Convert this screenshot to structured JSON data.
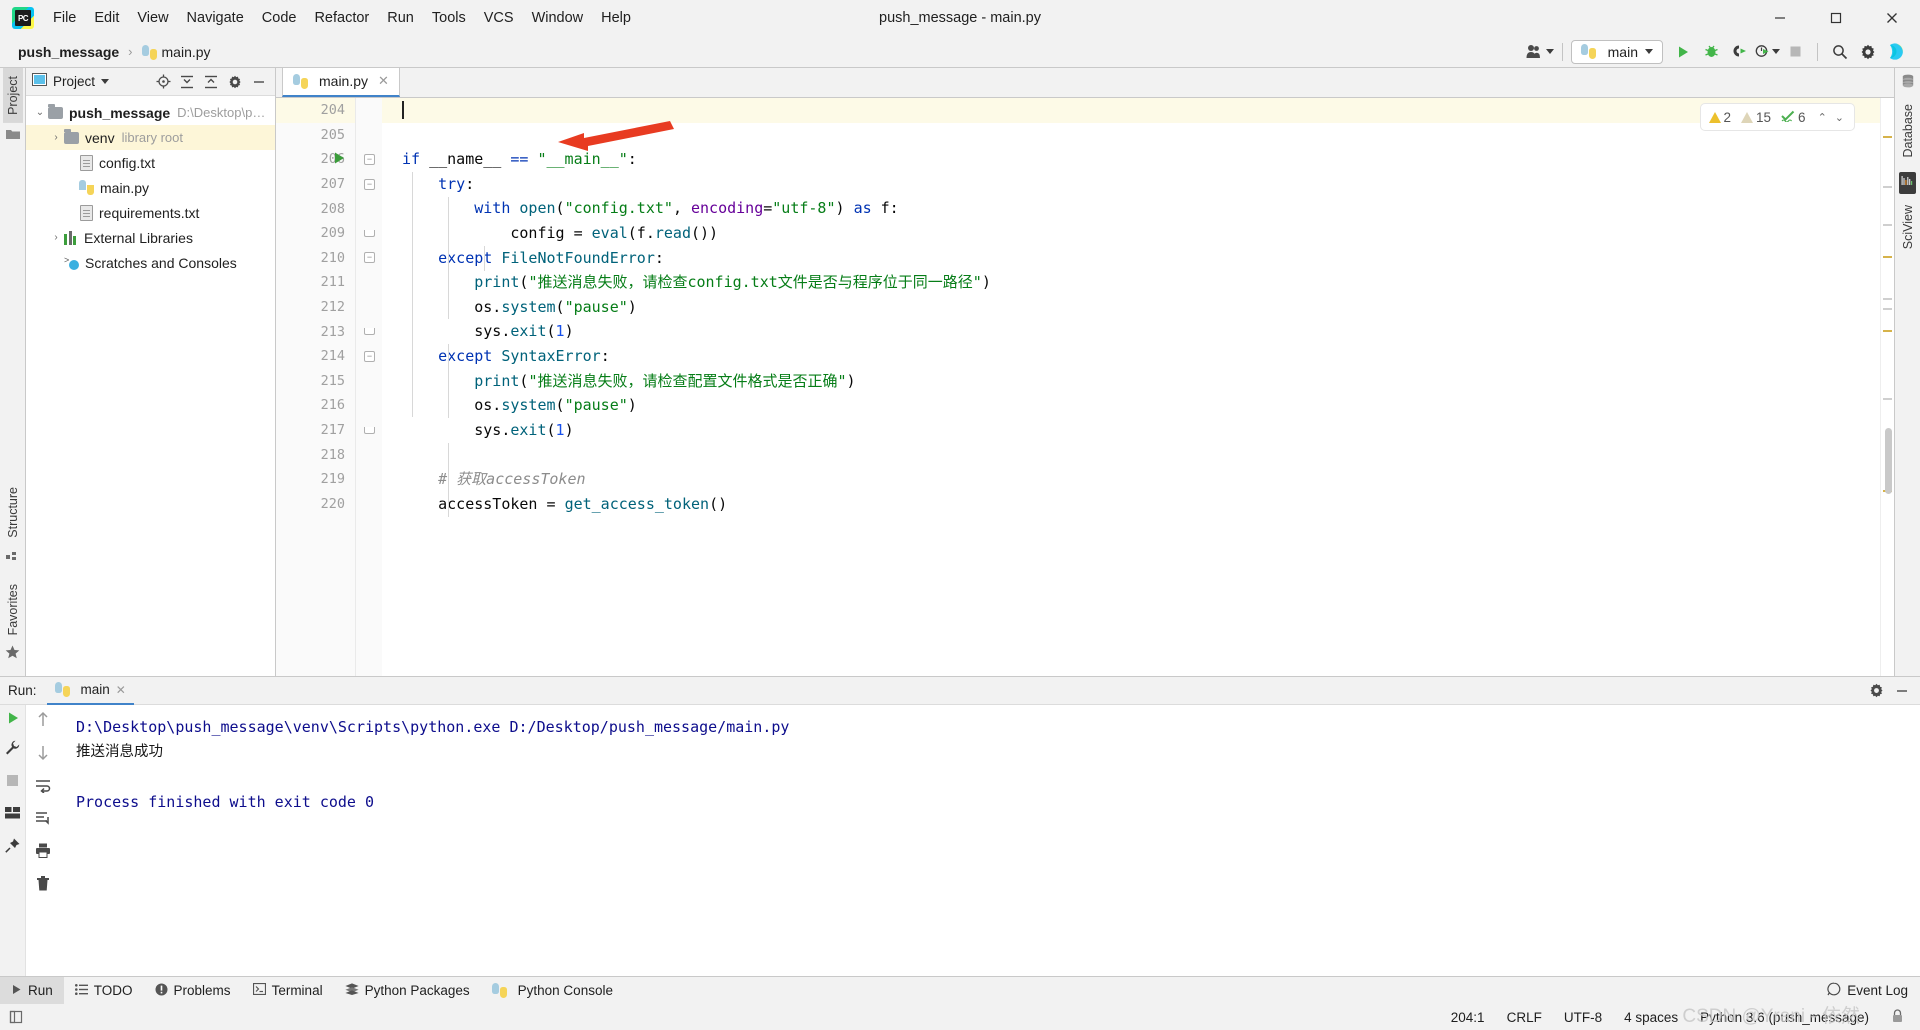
{
  "window": {
    "title": "push_message - main.py",
    "app_icon": "pycharm-logo-icon",
    "minimize": "–",
    "maximize": "▢",
    "close": "✕"
  },
  "menu": [
    {
      "label": "File"
    },
    {
      "label": "Edit"
    },
    {
      "label": "View"
    },
    {
      "label": "Navigate"
    },
    {
      "label": "Code"
    },
    {
      "label": "Refactor"
    },
    {
      "label": "Run"
    },
    {
      "label": "Tools"
    },
    {
      "label": "VCS"
    },
    {
      "label": "Window"
    },
    {
      "label": "Help"
    }
  ],
  "breadcrumb": {
    "project": "push_message",
    "separator": "›",
    "file": "main.py"
  },
  "toolbar": {
    "account_icon": "user-account-icon",
    "run_config_name": "main",
    "run_config_icon": "python-file-icon",
    "run_icon": "run-play-icon",
    "debug_icon": "debug-bug-icon",
    "run_coverage_icon": "run-with-coverage-icon",
    "profile_icon": "profiler-icon",
    "stop_icon": "stop-icon",
    "search_icon": "search-icon",
    "settings_icon": "gear-icon",
    "updates_icon": "ide-updates-icon"
  },
  "left_rail": {
    "project_tab": "Project",
    "structure_tab": "Structure",
    "favorites_tab": "Favorites"
  },
  "right_rail": {
    "database_tab": "Database",
    "sciview_tab": "SciView"
  },
  "project_panel": {
    "title": "Project",
    "dropdown_icon": "chevron-down-icon",
    "icons": [
      "locate-icon",
      "expand-all-icon",
      "collapse-all-icon",
      "gear-icon",
      "hide-icon"
    ],
    "tree": [
      {
        "label": "push_message",
        "hint": "D:\\Desktop\\push_m",
        "icon": "folder-icon",
        "depth": 0,
        "expanded": true,
        "bold": true,
        "selected": false
      },
      {
        "label": "venv",
        "hint": "library root",
        "icon": "folder-icon",
        "depth": 1,
        "expanded": false,
        "bold": false,
        "selected": true
      },
      {
        "label": "config.txt",
        "hint": "",
        "icon": "text-file-icon",
        "depth": 2,
        "expanded": null,
        "bold": false,
        "selected": false
      },
      {
        "label": "main.py",
        "hint": "",
        "icon": "python-file-icon",
        "depth": 2,
        "expanded": null,
        "bold": false,
        "selected": false
      },
      {
        "label": "requirements.txt",
        "hint": "",
        "icon": "text-file-icon",
        "depth": 2,
        "expanded": null,
        "bold": false,
        "selected": false
      },
      {
        "label": "External Libraries",
        "hint": "",
        "icon": "libraries-icon",
        "depth": 0,
        "expanded": false,
        "bold": false,
        "selected": false
      },
      {
        "label": "Scratches and Consoles",
        "hint": "",
        "icon": "scratches-icon",
        "depth": 1,
        "expanded": null,
        "bold": false,
        "selected": false
      }
    ]
  },
  "editor": {
    "tab": {
      "label": "main.py",
      "icon": "python-file-icon",
      "close": "✕"
    },
    "inspection": {
      "warning_count": "2",
      "weak_warning_count": "15",
      "typo_count": "6",
      "prev_icon": "chevron-up-icon",
      "next_icon": "chevron-down-icon"
    },
    "lines": [
      {
        "num": "204",
        "highlight": true,
        "gutter_run": false,
        "fold": "",
        "indent": 0,
        "tokens": [
          {
            "t": "caret",
            "v": ""
          }
        ]
      },
      {
        "num": "205",
        "highlight": false,
        "gutter_run": false,
        "fold": "",
        "indent": 0,
        "tokens": []
      },
      {
        "num": "206",
        "highlight": false,
        "gutter_run": true,
        "fold": "open",
        "indent": 0,
        "tokens": [
          {
            "t": "kw",
            "v": "if"
          },
          {
            "t": "id",
            "v": " __name__ "
          },
          {
            "t": "kw",
            "v": "=="
          },
          {
            "t": "id",
            "v": " "
          },
          {
            "t": "str",
            "v": "\"__main__\""
          },
          {
            "t": "id",
            "v": ":"
          }
        ]
      },
      {
        "num": "207",
        "highlight": false,
        "gutter_run": false,
        "fold": "open",
        "indent": 1,
        "tokens": [
          {
            "t": "kw",
            "v": "try"
          },
          {
            "t": "id",
            "v": ":"
          }
        ]
      },
      {
        "num": "208",
        "highlight": false,
        "gutter_run": false,
        "fold": "",
        "indent": 2,
        "tokens": [
          {
            "t": "kw",
            "v": "with"
          },
          {
            "t": "id",
            "v": " "
          },
          {
            "t": "fn",
            "v": "open"
          },
          {
            "t": "id",
            "v": "("
          },
          {
            "t": "str",
            "v": "\"config.txt\""
          },
          {
            "t": "id",
            "v": ", "
          },
          {
            "t": "param",
            "v": "encoding"
          },
          {
            "t": "id",
            "v": "="
          },
          {
            "t": "str",
            "v": "\"utf-8\""
          },
          {
            "t": "id",
            "v": ") "
          },
          {
            "t": "kw",
            "v": "as"
          },
          {
            "t": "id",
            "v": " f:"
          }
        ]
      },
      {
        "num": "209",
        "highlight": false,
        "gutter_run": false,
        "fold": "end",
        "indent": 3,
        "tokens": [
          {
            "t": "id",
            "v": "config = "
          },
          {
            "t": "fn",
            "v": "eval"
          },
          {
            "t": "id",
            "v": "(f."
          },
          {
            "t": "fn",
            "v": "read"
          },
          {
            "t": "id",
            "v": "())"
          }
        ]
      },
      {
        "num": "210",
        "highlight": false,
        "gutter_run": false,
        "fold": "open",
        "indent": 1,
        "tokens": [
          {
            "t": "kw",
            "v": "except"
          },
          {
            "t": "id",
            "v": " "
          },
          {
            "t": "fn",
            "v": "FileNotFoundError"
          },
          {
            "t": "id",
            "v": ":"
          }
        ]
      },
      {
        "num": "211",
        "highlight": false,
        "gutter_run": false,
        "fold": "",
        "indent": 2,
        "tokens": [
          {
            "t": "fn",
            "v": "print"
          },
          {
            "t": "id",
            "v": "("
          },
          {
            "t": "str",
            "v": "\"推送消息失败，请检查config.txt文件是否与程序位于同一路径\""
          },
          {
            "t": "id",
            "v": ")"
          }
        ]
      },
      {
        "num": "212",
        "highlight": false,
        "gutter_run": false,
        "fold": "",
        "indent": 2,
        "tokens": [
          {
            "t": "id",
            "v": "os."
          },
          {
            "t": "fn",
            "v": "system"
          },
          {
            "t": "id",
            "v": "("
          },
          {
            "t": "str",
            "v": "\"pause\""
          },
          {
            "t": "id",
            "v": ")"
          }
        ]
      },
      {
        "num": "213",
        "highlight": false,
        "gutter_run": false,
        "fold": "end",
        "indent": 2,
        "tokens": [
          {
            "t": "id",
            "v": "sys."
          },
          {
            "t": "fn",
            "v": "exit"
          },
          {
            "t": "id",
            "v": "("
          },
          {
            "t": "num",
            "v": "1"
          },
          {
            "t": "id",
            "v": ")"
          }
        ]
      },
      {
        "num": "214",
        "highlight": false,
        "gutter_run": false,
        "fold": "open",
        "indent": 1,
        "tokens": [
          {
            "t": "kw",
            "v": "except"
          },
          {
            "t": "id",
            "v": " "
          },
          {
            "t": "fn",
            "v": "SyntaxError"
          },
          {
            "t": "id",
            "v": ":"
          }
        ]
      },
      {
        "num": "215",
        "highlight": false,
        "gutter_run": false,
        "fold": "",
        "indent": 2,
        "tokens": [
          {
            "t": "fn",
            "v": "print"
          },
          {
            "t": "id",
            "v": "("
          },
          {
            "t": "str",
            "v": "\"推送消息失败，请检查配置文件格式是否正确\""
          },
          {
            "t": "id",
            "v": ")"
          }
        ]
      },
      {
        "num": "216",
        "highlight": false,
        "gutter_run": false,
        "fold": "",
        "indent": 2,
        "tokens": [
          {
            "t": "id",
            "v": "os."
          },
          {
            "t": "fn",
            "v": "system"
          },
          {
            "t": "id",
            "v": "("
          },
          {
            "t": "str",
            "v": "\"pause\""
          },
          {
            "t": "id",
            "v": ")"
          }
        ]
      },
      {
        "num": "217",
        "highlight": false,
        "gutter_run": false,
        "fold": "end",
        "indent": 2,
        "tokens": [
          {
            "t": "id",
            "v": "sys."
          },
          {
            "t": "fn",
            "v": "exit"
          },
          {
            "t": "id",
            "v": "("
          },
          {
            "t": "num",
            "v": "1"
          },
          {
            "t": "id",
            "v": ")"
          }
        ]
      },
      {
        "num": "218",
        "highlight": false,
        "gutter_run": false,
        "fold": "",
        "indent": 0,
        "tokens": []
      },
      {
        "num": "219",
        "highlight": false,
        "gutter_run": false,
        "fold": "",
        "indent": 1,
        "tokens": [
          {
            "t": "cmt",
            "v": "# 获取accessToken"
          }
        ]
      },
      {
        "num": "220",
        "highlight": false,
        "gutter_run": false,
        "fold": "",
        "indent": 1,
        "tokens": [
          {
            "t": "id",
            "v": "accessToken = "
          },
          {
            "t": "fn",
            "v": "get_access_token"
          },
          {
            "t": "id",
            "v": "()"
          }
        ]
      }
    ],
    "annotation": {
      "type": "red-arrow",
      "points_at": "if __name__ == \"__main__\":"
    }
  },
  "run_window": {
    "label": "Run:",
    "tab_name": "main",
    "tab_icon": "python-file-icon",
    "tab_close": "✕",
    "settings_icon": "gear-icon",
    "hide_icon": "hide-icon",
    "side_buttons": [
      "rerun-icon",
      "settings-wrench-icon",
      "stop-icon",
      "layout-icon",
      "pin-icon"
    ],
    "side_buttons2": [
      "up-arrow-icon",
      "down-arrow-icon",
      "soft-wrap-icon",
      "scroll-to-end-icon",
      "print-icon",
      "trash-icon"
    ],
    "console_lines": [
      {
        "text": "D:\\Desktop\\push_message\\venv\\Scripts\\python.exe D:/Desktop/push_message/main.py",
        "style": "cmd"
      },
      {
        "text": "推送消息成功",
        "style": "cjk"
      },
      {
        "text": "",
        "style": "blank"
      },
      {
        "text": "Process finished with exit code 0",
        "style": "cmd"
      }
    ]
  },
  "bottom_bar": {
    "items": [
      {
        "label": "Run",
        "icon": "run-play-icon",
        "active": true
      },
      {
        "label": "TODO",
        "icon": "todo-list-icon",
        "active": false
      },
      {
        "label": "Problems",
        "icon": "problems-icon",
        "active": false
      },
      {
        "label": "Terminal",
        "icon": "terminal-icon",
        "active": false
      },
      {
        "label": "Python Packages",
        "icon": "packages-icon",
        "active": false
      },
      {
        "label": "Python Console",
        "icon": "python-console-icon",
        "active": false
      }
    ],
    "event_log": {
      "label": "Event Log",
      "icon": "event-log-icon"
    }
  },
  "status_bar": {
    "toggle_icon": "toggle-toolwindow-icon",
    "caret_position": "204:1",
    "line_separator": "CRLF",
    "encoding": "UTF-8",
    "indent": "4 spaces",
    "interpreter": "Python 3.6 (push_message)",
    "lock_icon": "lock-icon"
  },
  "watermark": "CSDN @Yrani - 依然",
  "colors": {
    "accent_blue": "#4083c9",
    "keyword": "#0033b3",
    "string": "#067d17",
    "number": "#1750eb",
    "function": "#00627a",
    "param": "#660099",
    "comment": "#8c8c8c",
    "console_text": "#0d0d8c",
    "selection_yellow": "#fdf6d8",
    "warning_yellow": "#ecc02c",
    "arrow_red": "#e83b21"
  }
}
